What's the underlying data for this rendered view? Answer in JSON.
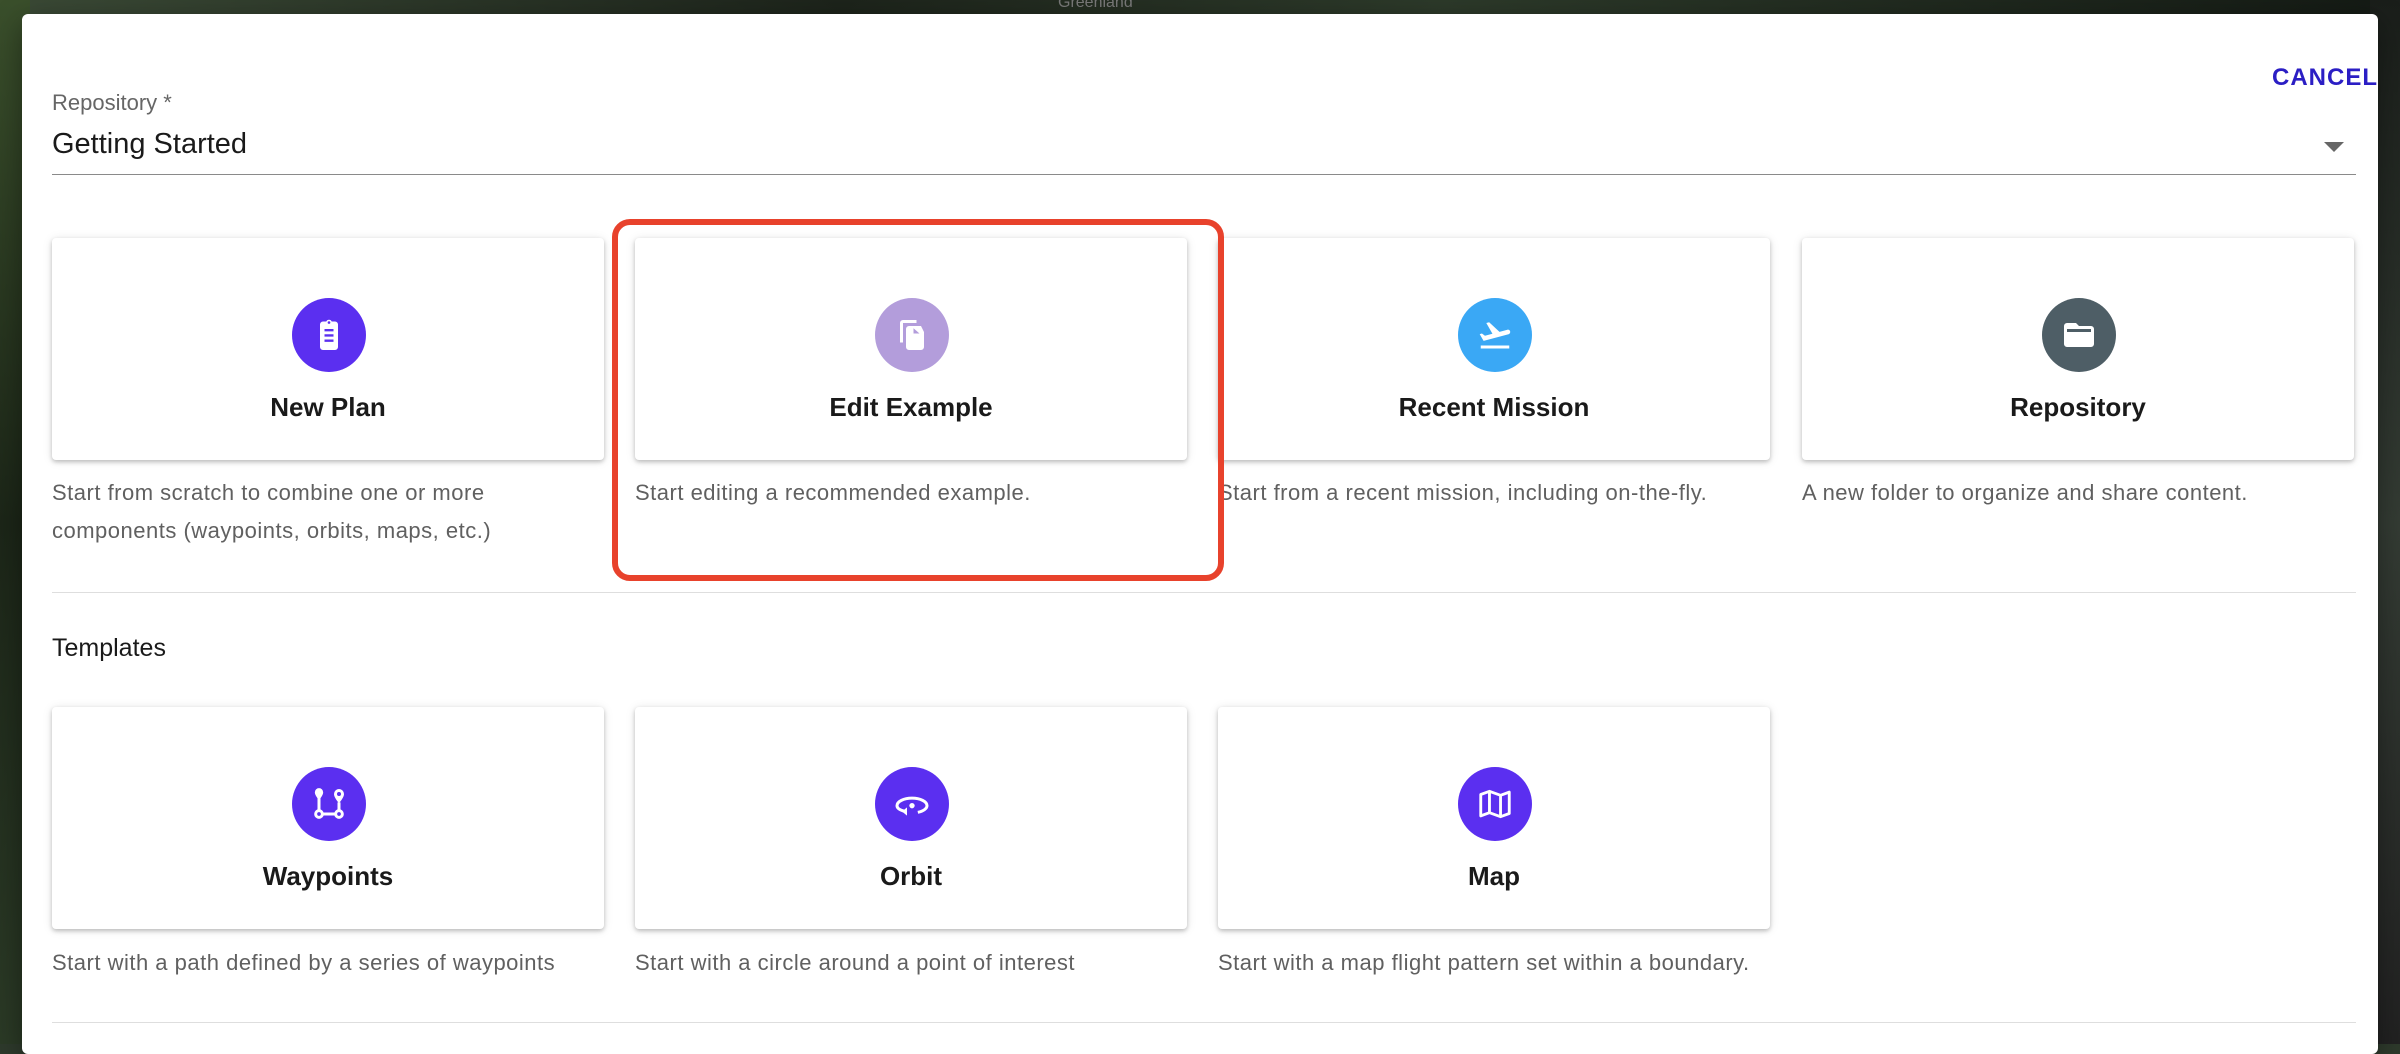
{
  "background": {
    "label": "Greenland"
  },
  "dialog": {
    "cancel_label": "CANCEL",
    "repository": {
      "label": "Repository *",
      "value": "Getting Started"
    }
  },
  "create_options": [
    {
      "title": "New Plan",
      "description": "Start from scratch to combine one or more components (waypoints, orbits, maps, etc.)",
      "icon": "clipboard-icon",
      "color": "#5b2ff0"
    },
    {
      "title": "Edit Example",
      "description": "Start editing a recommended example.",
      "icon": "copy-file-icon",
      "color": "#b39ddb"
    },
    {
      "title": "Recent Mission",
      "description": "Start from a recent mission, including on-the-fly.",
      "icon": "flight-takeoff-icon",
      "color": "#3aa8f5"
    },
    {
      "title": "Repository",
      "description": "A new folder to organize and share content.",
      "icon": "folder-open-icon",
      "color": "#4e5e66"
    }
  ],
  "templates": {
    "title": "Templates",
    "items": [
      {
        "title": "Waypoints",
        "description": "Start with a path defined by a series of waypoints",
        "icon": "waypoints-route-icon",
        "color": "#5b2ff0"
      },
      {
        "title": "Orbit",
        "description": "Start with a circle around a point of interest",
        "icon": "orbit-icon",
        "color": "#5b2ff0"
      },
      {
        "title": "Map",
        "description": "Start with a map flight pattern set within a boundary.",
        "icon": "map-icon",
        "color": "#5b2ff0"
      }
    ]
  },
  "highlight_color": "#e8422c"
}
